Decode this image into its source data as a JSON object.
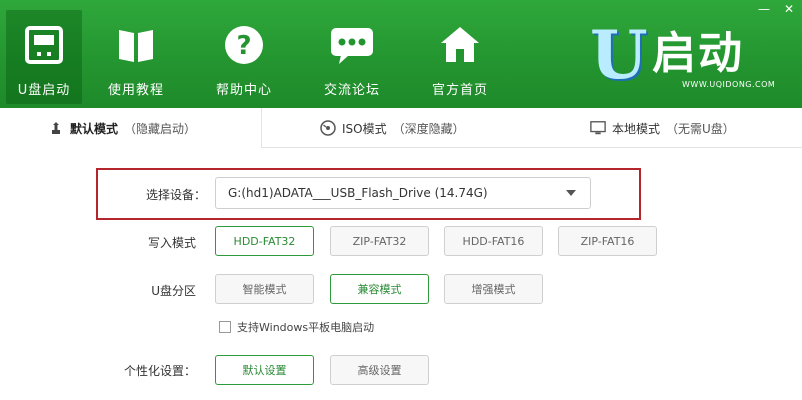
{
  "window": {
    "minimize": "—",
    "close": "✕"
  },
  "nav": [
    {
      "label": "U盘启动",
      "icon": "usb-drive-icon",
      "active": true
    },
    {
      "label": "使用教程",
      "icon": "book-icon"
    },
    {
      "label": "帮助中心",
      "icon": "question-icon"
    },
    {
      "label": "交流论坛",
      "icon": "chat-bubble-icon"
    },
    {
      "label": "官方首页",
      "icon": "home-icon"
    }
  ],
  "logo": {
    "letter": "U",
    "text": "启动",
    "url": "WWW.UQIDONG.COM"
  },
  "tabs": [
    {
      "main": "默认模式",
      "sub": "（隐藏启动）",
      "icon": "usb-small-icon",
      "active": true
    },
    {
      "main": "ISO模式",
      "sub": "（深度隐藏）",
      "icon": "disc-icon"
    },
    {
      "main": "本地模式",
      "sub": "（无需U盘）",
      "icon": "monitor-icon"
    }
  ],
  "device": {
    "label": "选择设备：",
    "value": "G:(hd1)ADATA___USB_Flash_Drive (14.74G)"
  },
  "write_mode": {
    "label": "写入模式",
    "options": [
      "HDD-FAT32",
      "ZIP-FAT32",
      "HDD-FAT16",
      "ZIP-FAT16"
    ],
    "selected": "HDD-FAT32"
  },
  "partition": {
    "label": "U盘分区",
    "options": [
      "智能模式",
      "兼容模式",
      "增强模式"
    ],
    "selected": "兼容模式"
  },
  "windows_tablet": {
    "label": "支持Windows平板电脑启动",
    "checked": false
  },
  "personalize": {
    "label": "个性化设置：",
    "options": [
      "默认设置",
      "高级设置"
    ],
    "selected": "默认设置"
  },
  "colors": {
    "header": "#23942f",
    "accent": "#2a8a35",
    "highlight": "#b4262b"
  }
}
